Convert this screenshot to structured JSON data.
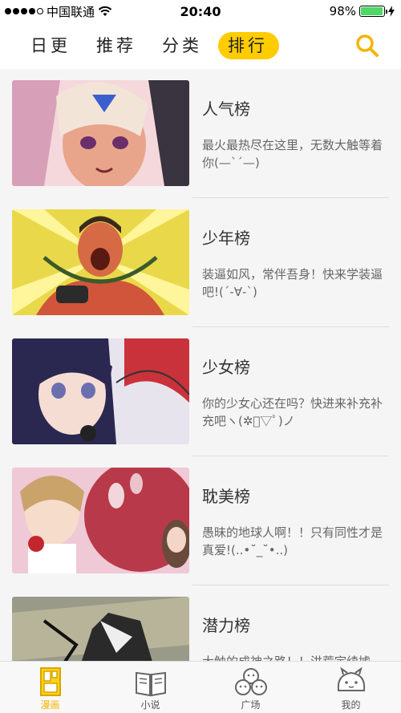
{
  "status_bar": {
    "carrier": "中国联通",
    "time": "20:40",
    "battery": "98%",
    "battery_level": 0.98
  },
  "top_nav": {
    "tabs": [
      {
        "label": "日更"
      },
      {
        "label": "推荐"
      },
      {
        "label": "分类"
      },
      {
        "label": "排行"
      }
    ],
    "active_tab": "排行",
    "accent_color": "#ffcc00"
  },
  "rankings": [
    {
      "title": "人气榜",
      "desc": "最火最热尽在这里，无数大触等着你(—`´—)"
    },
    {
      "title": "少年榜",
      "desc": "装逼如风，常伴吾身！快来学装逼吧!(´-∀-`)"
    },
    {
      "title": "少女榜",
      "desc": "你的少女心还在吗？快进来补充补充吧ヽ(✲ﾟ▽ﾟ)ノ"
    },
    {
      "title": "耽美榜",
      "desc": "愚昧的地球人啊！！只有同性才是真爱!(..•˘_˘•..)"
    },
    {
      "title": "潜力榜",
      "desc": "大触的成神之路！！洪荒宇续掳"
    }
  ],
  "tab_bar": {
    "items": [
      {
        "label": "漫画",
        "icon": "manga-icon"
      },
      {
        "label": "小说",
        "icon": "book-icon"
      },
      {
        "label": "广场",
        "icon": "square-icon"
      },
      {
        "label": "我的",
        "icon": "profile-icon"
      }
    ],
    "active": "漫画"
  }
}
